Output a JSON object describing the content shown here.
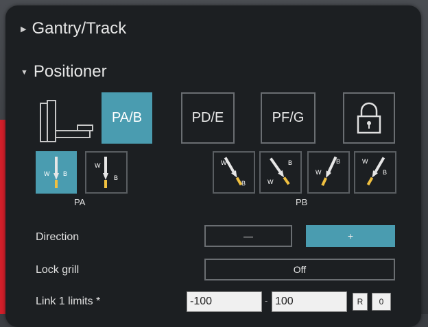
{
  "sections": {
    "gantry": {
      "title": "Gantry/Track",
      "expanded": false
    },
    "positioner": {
      "title": "Positioner",
      "expanded": true
    }
  },
  "position_tabs": {
    "pab": "PA/B",
    "pde": "PD/E",
    "pfg": "PF/G",
    "selected": "PA/B"
  },
  "torch_groups": {
    "pa_label": "PA",
    "pb_label": "PB",
    "icon_text": {
      "w": "W",
      "b": "B"
    }
  },
  "direction": {
    "label": "Direction",
    "minus": "—",
    "plus": "+",
    "selected": "+"
  },
  "lock_grill": {
    "label": "Lock grill",
    "value": "Off"
  },
  "link_limits": {
    "label": "Link 1 limits *",
    "min": "-100",
    "separator": "-",
    "max": "100",
    "r_label": "R",
    "r_value": "0"
  },
  "colors": {
    "accent": "#4a9cb0",
    "panel": "#1c1f22",
    "side": "#d21f2a"
  }
}
